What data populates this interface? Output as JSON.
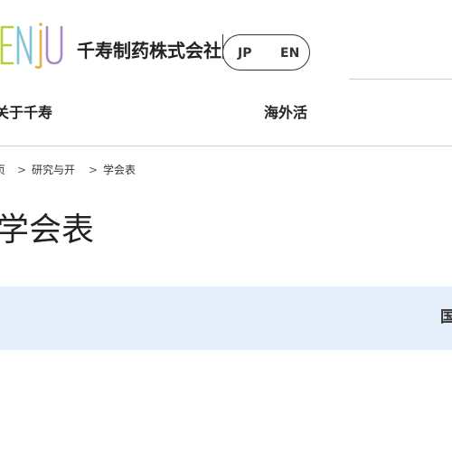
{
  "header": {
    "logo_text": "SENJU",
    "company_name": "千寿制药株式会社",
    "lang": {
      "jp": "JP",
      "en": "EN"
    }
  },
  "nav": {
    "about": "关于千寿",
    "overseas": "海外活"
  },
  "breadcrumb": {
    "home": "页",
    "separator": ">",
    "research": "研究与开",
    "current": "学会表"
  },
  "page": {
    "title": "学会表",
    "band_text": "国"
  },
  "colors": {
    "band_background": "#e4effb",
    "logo_s": "#e8b84a",
    "logo_e": "#b7cf3a",
    "logo_n": "#7fc4d8",
    "logo_j": "#e3b04a",
    "logo_u": "#a98bc4"
  }
}
